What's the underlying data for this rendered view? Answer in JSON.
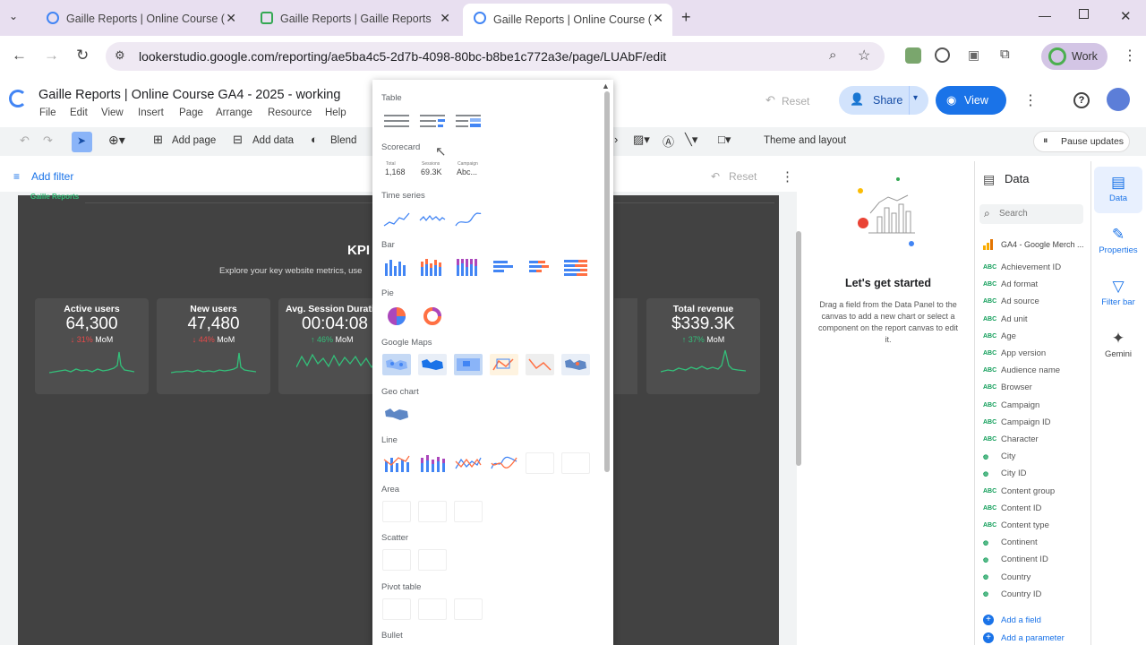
{
  "browser": {
    "tabs": [
      {
        "title": "Gaille Reports | Online Course (",
        "active": false
      },
      {
        "title": "Gaille Reports | Gaille Reports",
        "active": false
      },
      {
        "title": "Gaille Reports | Online Course (",
        "active": true
      }
    ],
    "url": "lookerstudio.google.com/reporting/ae5ba4c5-2d7b-4098-80bc-b8be1c772a3e/page/LUAbF/edit",
    "profile_label": "Work"
  },
  "app": {
    "title": "Gaille Reports | Online Course GA4 - 2025 - working",
    "menu": [
      "File",
      "Edit",
      "View",
      "Insert",
      "Page",
      "Arrange",
      "Resource",
      "Help"
    ],
    "reset_label": "Reset",
    "share_label": "Share",
    "view_label": "View"
  },
  "toolbar": {
    "add_page": "Add page",
    "add_data": "Add data",
    "blend": "Blend",
    "theme_layout": "Theme and layout",
    "pause_updates": "Pause updates"
  },
  "filterbar": {
    "add_filter": "Add filter",
    "reset_label": "Reset"
  },
  "report": {
    "brand": "Gaille Reports",
    "kpi_title": "KPI",
    "kpi_subtitle": "Explore your key website metrics, use",
    "cards": [
      {
        "label": "Active users",
        "value": "64,300",
        "change": "↓ 31%",
        "change_dir": "neg",
        "period": "MoM"
      },
      {
        "label": "New users",
        "value": "47,480",
        "change": "↓ 44%",
        "change_dir": "neg",
        "period": "MoM"
      },
      {
        "label": "Avg. Session Duratio",
        "value": "00:04:08",
        "change": "↑ 46%",
        "change_dir": "pos",
        "period": "MoM"
      },
      {
        "label": "Total revenue",
        "value": "$339.3K",
        "change": "↑ 37%",
        "change_dir": "pos",
        "period": "MoM"
      }
    ]
  },
  "chart_menu": {
    "sections": {
      "table": "Table",
      "scorecard": "Scorecard",
      "time_series": "Time series",
      "bar": "Bar",
      "pie": "Pie",
      "google_maps": "Google Maps",
      "geo_chart": "Geo chart",
      "line": "Line",
      "area": "Area",
      "scatter": "Scatter",
      "pivot_table": "Pivot table",
      "bullet": "Bullet"
    },
    "scorecard_previews": [
      {
        "label": "Total",
        "value": "1,168"
      },
      {
        "label": "Sessions",
        "value": "69.3K"
      },
      {
        "label": "Campaign",
        "value": "Abc..."
      }
    ]
  },
  "get_started": {
    "title": "Let's get started",
    "text": "Drag a field from the Data Panel to the canvas to add a new chart or select a component on the report canvas to edit it."
  },
  "data_panel": {
    "title": "Data",
    "search_placeholder": "Search",
    "source": "GA4 - Google Merch ...",
    "fields": [
      {
        "name": "Achievement ID",
        "type": "text"
      },
      {
        "name": "Ad format",
        "type": "text"
      },
      {
        "name": "Ad source",
        "type": "text"
      },
      {
        "name": "Ad unit",
        "type": "text"
      },
      {
        "name": "Age",
        "type": "text"
      },
      {
        "name": "App version",
        "type": "text"
      },
      {
        "name": "Audience name",
        "type": "text"
      },
      {
        "name": "Browser",
        "type": "text"
      },
      {
        "name": "Campaign",
        "type": "text"
      },
      {
        "name": "Campaign ID",
        "type": "text"
      },
      {
        "name": "Character",
        "type": "text"
      },
      {
        "name": "City",
        "type": "geo"
      },
      {
        "name": "City ID",
        "type": "geo"
      },
      {
        "name": "Content group",
        "type": "text"
      },
      {
        "name": "Content ID",
        "type": "text"
      },
      {
        "name": "Content type",
        "type": "text"
      },
      {
        "name": "Continent",
        "type": "geo"
      },
      {
        "name": "Continent ID",
        "type": "geo"
      },
      {
        "name": "Country",
        "type": "geo"
      },
      {
        "name": "Country ID",
        "type": "geo"
      }
    ],
    "add_field": "Add a field",
    "add_parameter": "Add a parameter"
  },
  "rail": {
    "data": "Data",
    "properties": "Properties",
    "filter_bar": "Filter bar",
    "gemini": "Gemini"
  },
  "colors": {
    "accent": "#1a73e8",
    "canvas": "#424242",
    "sparkline": "#33c07a",
    "negative": "#e84a4a"
  }
}
